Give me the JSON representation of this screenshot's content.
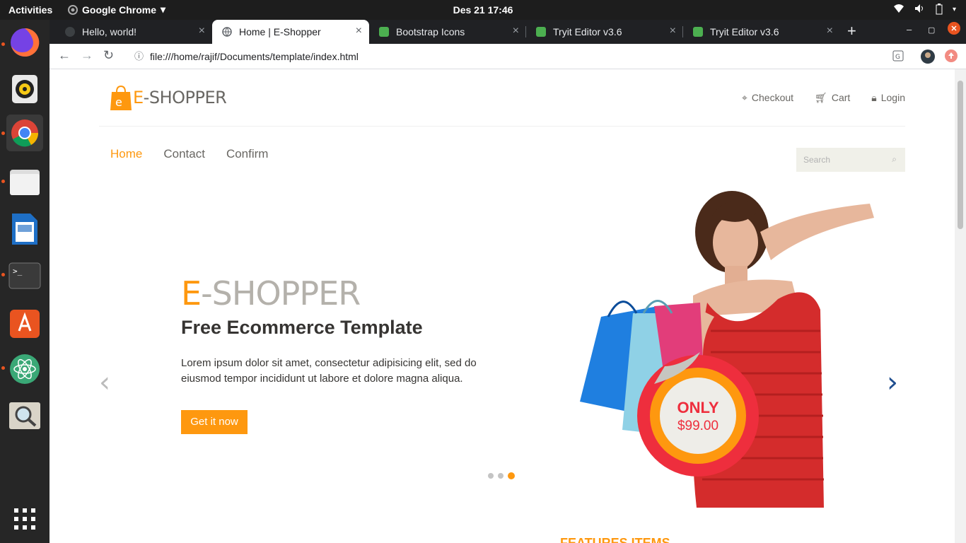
{
  "system": {
    "activities": "Activities",
    "app_name": "Google Chrome",
    "clock": "Des 21  17:46"
  },
  "browser": {
    "tabs": [
      {
        "title": "Hello, world!"
      },
      {
        "title": "Home | E-Shopper"
      },
      {
        "title": "Bootstrap Icons"
      },
      {
        "title": "Tryit Editor v3.6"
      },
      {
        "title": "Tryit Editor v3.6"
      }
    ],
    "url": "file:///home/rajif/Documents/template/index.html"
  },
  "site": {
    "logo_letter": "e",
    "logo_first": "E",
    "logo_rest": "-SHOPPER",
    "top_links": [
      {
        "label": "Checkout",
        "icon": "crosshair-icon"
      },
      {
        "label": "Cart",
        "icon": "cart-icon"
      },
      {
        "label": "Login",
        "icon": "lock-icon"
      }
    ],
    "nav": [
      {
        "label": "Home"
      },
      {
        "label": "Contact"
      },
      {
        "label": "Confirm"
      }
    ],
    "search_placeholder": "Search",
    "slider": {
      "title_first": "E",
      "title_rest": "-SHOPPER",
      "subtitle": "Free Ecommerce Template",
      "text": "Lorem ipsum dolor sit amet, consectetur adipisicing elit, sed do eiusmod tempor incididunt ut labore et dolore magna aliqua.",
      "button": "Get it now",
      "badge_top": "ONLY",
      "badge_price": "$99.00",
      "active_slide": 3,
      "slide_count": 3
    },
    "features_heading": "FEATURES ITEMS"
  },
  "colors": {
    "accent": "#fe980f",
    "text": "#696763",
    "dark": "#363432"
  }
}
